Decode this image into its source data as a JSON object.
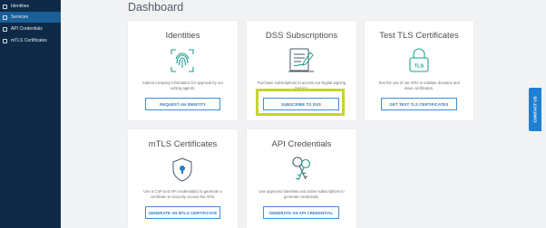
{
  "sidebar": {
    "items": [
      {
        "label": "Identities",
        "active": false
      },
      {
        "label": "Services",
        "active": true
      },
      {
        "label": "API Credentials",
        "active": false
      },
      {
        "label": "mTLS Certificates",
        "active": false
      }
    ]
  },
  "page": {
    "title": "Dashboard"
  },
  "cards": {
    "identities": {
      "title": "Identities",
      "desc": "Submit company information for approval by our vetting agents.",
      "button": "REQUEST AN IDENTITY",
      "icon": "fingerprint-icon"
    },
    "dss": {
      "title": "DSS Subscriptions",
      "desc": "Purchase subscriptions to access our Digital Signing Service.",
      "button": "SUBSCRIBE TO DSS",
      "icon": "document-signing-icon"
    },
    "tls": {
      "title": "Test TLS Certificates",
      "desc": "Test the use of our APIs to validate domains and issue certificates.",
      "button": "GET TEST TLS CERTIFICATES",
      "icon": "tls-lock-icon"
    },
    "mtls": {
      "title": "mTLS Certificates",
      "desc": "Use a CSP and API credential(s) to generate a certificate to securely access the APIs.",
      "button": "GENERATE AN MTLS CERTIFICATE",
      "icon": "shield-lock-icon"
    },
    "api": {
      "title": "API Credentials",
      "desc": "Use approved identities and active subscriptions to generate credentials.",
      "button": "GENERATE AN API CREDENTIAL",
      "icon": "keys-icon"
    }
  },
  "contact": {
    "label": "CONTACT US"
  },
  "colors": {
    "sidebar": "#0e2a47",
    "active": "#1b5f99",
    "accent": "#3d8fd6",
    "highlight": "#c5d629",
    "icon_teal": "#1f9e8f"
  }
}
